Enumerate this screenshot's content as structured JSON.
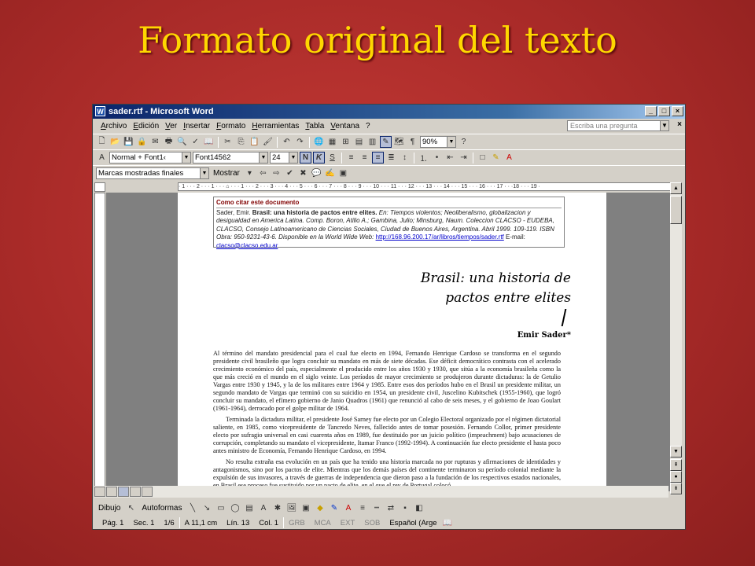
{
  "slide": {
    "title": "Formato original del texto"
  },
  "window": {
    "title": "sader.rtf - Microsoft Word"
  },
  "menu": {
    "items": [
      "Archivo",
      "Edición",
      "Ver",
      "Insertar",
      "Formato",
      "Herramientas",
      "Tabla",
      "Ventana",
      "?"
    ],
    "ask_placeholder": "Escriba una pregunta"
  },
  "toolbar": {
    "zoom": "90%"
  },
  "format_bar": {
    "style": "Normal + Font1‹",
    "font": "Font14562",
    "size": "24",
    "bold": "N",
    "italic": "K",
    "underline": "S"
  },
  "review_bar": {
    "markup": "Marcas mostradas finales",
    "show": "Mostrar"
  },
  "ruler": {
    "text": "· 1 · · · 2 · · · 1 · · · ⌂ · · · 1 · · · 2 · · · 3 · · · 4 · · · 5 · · · 6 · · · 7 · · · 8 · · · 9 · · · 10 · · · 11 · · · 12 · · · 13 · · · 14 · · · 15 · · · 16 · · · 17 · · ·18 · · · 19 ·"
  },
  "document": {
    "cite_heading": "Como citar este documento",
    "cite_line1": "Sader, Emir. ",
    "cite_bold": "Brasil: una historia de pactos entre elites.",
    "cite_rest": " En: Tiempos violentos; Neoliberalismo, globalizacion y desigualdad en America Latina. Comp. Boron, Atilio A.; Gambina, Julio; Minsburg, Naum. Coleccion CLACSO - EUDEBA, CLACSO, Consejo Latinoamericano de Ciencias Sociales, Ciudad de Buenos Aires, Argentina. Abril 1999. 109-119. ISBN Obra: 950-9231-43-6. Disponible en la World Wide Web:",
    "cite_url": "http://168.96.200.17/ar/libros/tiempos/sader.rtf",
    "cite_email_label": "E-mail: ",
    "cite_email": "clacso@clacso.edu.ar",
    "title_line1": "Brasil: una historia de",
    "title_line2": "pactos entre elites",
    "author": "Emir Sader*",
    "para1": "Al término del mandato presidencial para el cual fue electo en 1994, Fernando Henrique Cardoso se transforma en el segundo presidente civil brasileño que logra concluir su mandato en más de siete décadas. Ese déficit democrático contrasta con el acelerado crecimiento económico del país, especialmente el producido entre los años 1930 y 1930, que sitúa a la economía brasileña como la que más creció en el mundo en el siglo veinte. Los períodos de mayor crecimiento se produjeron durante dictaduras: la de Getulio Vargas entre 1930 y 1945, y la de los militares entre 1964 y 1985. Entre esos dos períodos hubo en el Brasil un presidente militar, un segundo mandato de Vargas que terminó con su suicidio en 1954, un presidente civil, Juscelino Kubitschek (1955-1960), que logró concluir su mandato, el efímero gobierno de Janio Quadros (1961) que renunció al cabo de seis meses, y el gobierno de Joao Goulart (1961-1964), derrocado por el golpe militar de 1964.",
    "para2": "Terminada la dictadura militar, el presidente José Sarney fue electo por un Colegio Electoral organizado por el régimen dictatorial saliente, en 1985, como vicepresidente de Tancredo Neves, fallecido antes de tomar posesión. Fernando Collor, primer presidente electo por sufragio universal en casi cuarenta años en 1989, fue destituido por un juicio político (impeachment) bajo acusaciones de corrupción, completando su mandato el vicepresidente, Itamar Franco (1992-1994). A continuación fue electo presidente el hasta poco antes ministro de Economía, Fernando Henrique Cardoso, en 1994.",
    "para3": "No resulta extraña esa evolución en un país que ha tenido una historia marcada no por rupturas y afirmaciones de identidades y antagonismos, sino por los pactos de elite. Mientras que los demás países del continente terminaron su período colonial mediante la expulsión de sus invasores, a través de guerras de independencia que dieron paso a la fundación de los respectivos estados nacionales, en Brasil ese proceso fue sustituido por un pacto de elite, en el que el rey de Portugal colocó"
  },
  "drawing_bar": {
    "dibujo": "Dibujo",
    "autoformas": "Autoformas"
  },
  "status": {
    "page": "Pág. 1",
    "section": "Sec. 1",
    "pages": "1/6",
    "position": "A 11,1 cm",
    "line": "Lín. 13",
    "column": "Col. 1",
    "grb": "GRB",
    "mca": "MCA",
    "ext": "EXT",
    "sob": "SOB",
    "language": "Español (Arge"
  }
}
